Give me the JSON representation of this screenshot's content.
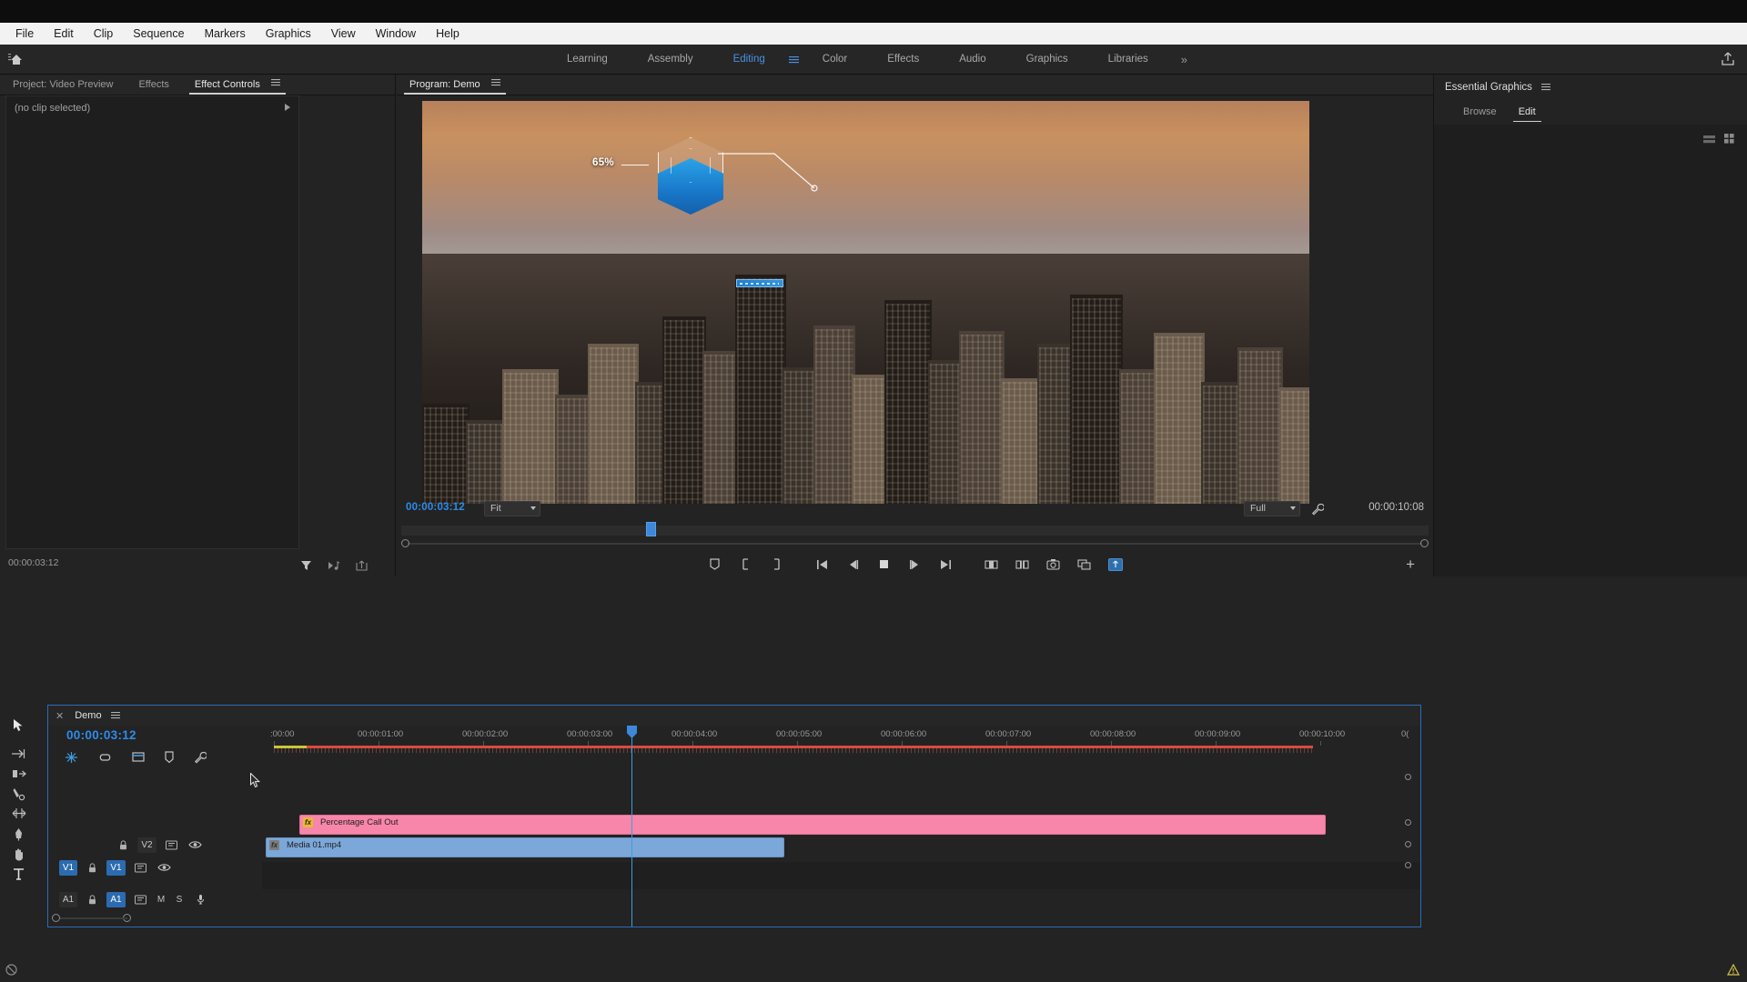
{
  "app": {
    "name": "Adobe Premiere Pro",
    "accent_blue": "#2d8ceb",
    "menu_bar_bg": "#f2f2f2",
    "panel_bg": "#232323"
  },
  "menu": {
    "items": [
      {
        "label": "File"
      },
      {
        "label": "Edit"
      },
      {
        "label": "Clip"
      },
      {
        "label": "Sequence"
      },
      {
        "label": "Markers"
      },
      {
        "label": "Graphics"
      },
      {
        "label": "View"
      },
      {
        "label": "Window"
      },
      {
        "label": "Help"
      }
    ]
  },
  "workspace": {
    "home_icon": "home-icon",
    "tabs": [
      {
        "label": "Learning",
        "active": false
      },
      {
        "label": "Assembly",
        "active": false
      },
      {
        "label": "Editing",
        "active": true
      },
      {
        "label": "Color",
        "active": false
      },
      {
        "label": "Effects",
        "active": false
      },
      {
        "label": "Audio",
        "active": false
      },
      {
        "label": "Graphics",
        "active": false
      },
      {
        "label": "Libraries",
        "active": false
      }
    ],
    "overflow_label": "»",
    "menu_icon": "hamburger-icon",
    "share_icon": "share-export-icon"
  },
  "left_panel": {
    "tabs": [
      {
        "label": "Project: Video Preview",
        "active": false
      },
      {
        "label": "Effects",
        "active": false
      },
      {
        "label": "Effect Controls",
        "active": true
      }
    ],
    "panel_menu_icon": "hamburger-icon",
    "empty_message": "(no clip selected)",
    "timecode": "00:00:03:12",
    "footer_icons": [
      "filter-icon",
      "audio-transition-icon",
      "export-frame-icon"
    ]
  },
  "program_monitor": {
    "tab_label": "Program: Demo",
    "panel_menu_icon": "hamburger-icon",
    "current_timecode": "00:00:03:12",
    "duration_timecode": "00:00:10:08",
    "fit_label": "Fit",
    "resolution_label": "Full",
    "wrench_icon": "settings-wrench-icon",
    "graphic_overlay": {
      "percentage_label": "65%",
      "hex_color": "#1d86d4"
    },
    "transport_buttons": [
      {
        "icon": "add-marker-icon",
        "label": "Add Marker"
      },
      {
        "icon": "mark-in-icon",
        "label": "Mark In"
      },
      {
        "icon": "mark-out-icon",
        "label": "Mark Out"
      },
      {
        "icon": "go-to-in-icon",
        "label": "Go to In"
      },
      {
        "icon": "step-back-icon",
        "label": "Step Back"
      },
      {
        "icon": "play-stop-icon",
        "label": "Play-Stop Toggle"
      },
      {
        "icon": "step-forward-icon",
        "label": "Step Forward"
      },
      {
        "icon": "go-to-out-icon",
        "label": "Go to Out"
      },
      {
        "icon": "lift-icon",
        "label": "Lift"
      },
      {
        "icon": "extract-icon",
        "label": "Extract"
      },
      {
        "icon": "export-frame-icon",
        "label": "Export Frame"
      },
      {
        "icon": "comparison-view-icon",
        "label": "Comparison View"
      },
      {
        "icon": "button-editor-icon",
        "label": "Button Editor"
      }
    ],
    "plus_button_label": "+"
  },
  "essential_graphics": {
    "title": "Essential Graphics",
    "panel_menu_icon": "hamburger-icon",
    "tabs": [
      {
        "label": "Browse",
        "active": false
      },
      {
        "label": "Edit",
        "active": true
      }
    ],
    "toolbar_icons": [
      "list-view-icon",
      "grid-view-icon"
    ]
  },
  "timeline": {
    "tab_close_icon": "close-icon",
    "sequence_name": "Demo",
    "panel_menu_icon": "hamburger-icon",
    "playhead_timecode": "00:00:03:12",
    "tools": [
      "snap-icon",
      "linked-selection-icon",
      "add-marker-icon",
      "marker-icon",
      "timeline-settings-icon"
    ],
    "ruler_labels": [
      ":00:00",
      "00:00:01:00",
      "00:00:02:00",
      "00:00:03:00",
      "00:00:04:00",
      "00:00:05:00",
      "00:00:06:00",
      "00:00:07:00",
      "00:00:08:00",
      "00:00:09:00",
      "00:00:10:00",
      "0("
    ],
    "tracks": [
      {
        "id": "V2",
        "label": "V2",
        "source_label": "",
        "type": "video",
        "targeted": false,
        "lock_icon": "lock-icon",
        "sync_icon": "sync-lock-icon",
        "eye_icon": "eye-icon",
        "clips": [
          {
            "name": "Percentage Call Out",
            "color": "#f886aa",
            "fx": true,
            "fx_color": "#e8b83c"
          }
        ]
      },
      {
        "id": "V1",
        "label": "V1",
        "source_label": "V1",
        "type": "video",
        "targeted": true,
        "lock_icon": "lock-icon",
        "sync_icon": "sync-lock-icon",
        "eye_icon": "eye-icon",
        "clips": [
          {
            "name": "Media 01.mp4",
            "color": "#7ba7d9",
            "fx": true,
            "fx_color": "#7d7d7d"
          }
        ]
      },
      {
        "id": "A1",
        "label": "A1",
        "source_label": "A1",
        "type": "audio",
        "targeted": true,
        "lock_icon": "lock-icon",
        "mute_label": "M",
        "solo_label": "S",
        "mic_icon": "microphone-icon",
        "clips": []
      }
    ]
  },
  "status_bar": {
    "left_icon": "no-drop-icon",
    "right_icon": "warning-icon"
  }
}
